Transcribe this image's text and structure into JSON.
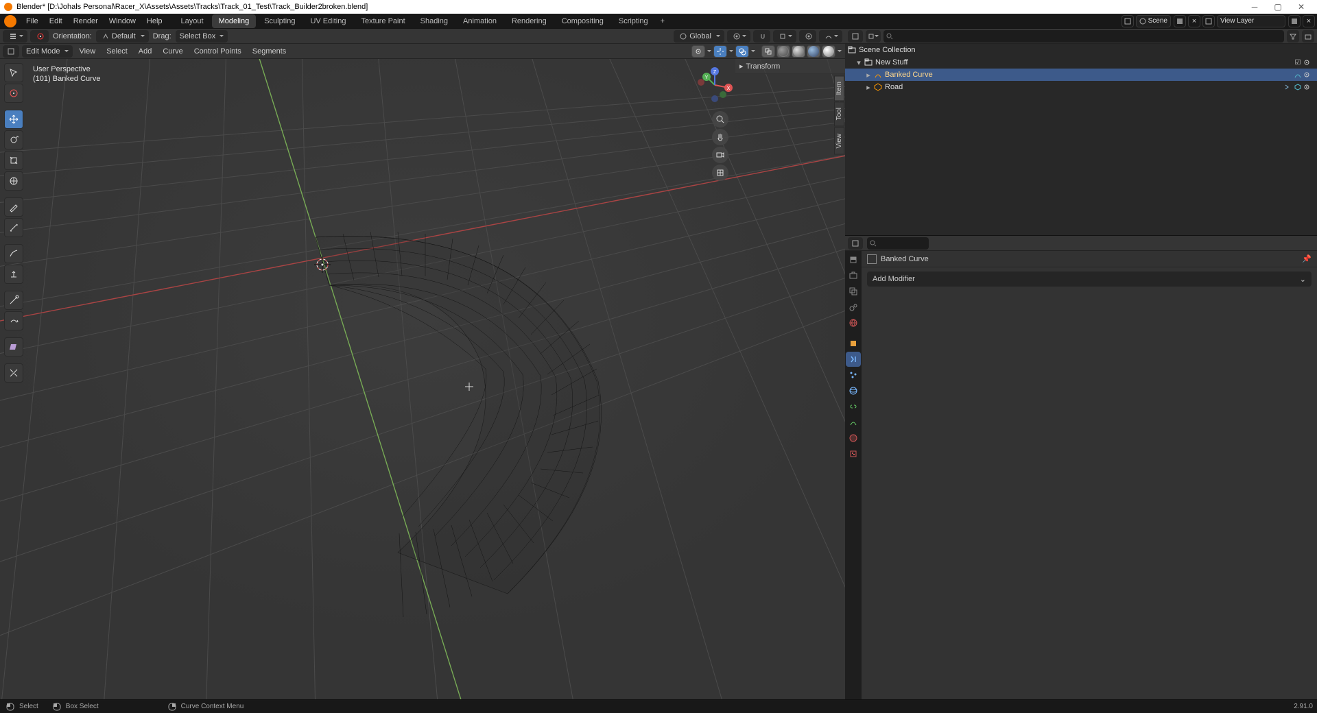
{
  "window": {
    "title": "Blender* [D:\\Johals Personal\\Racer_X\\Assets\\Assets\\Tracks\\Track_01_Test\\Track_Builder2broken.blend]"
  },
  "menu": {
    "items": [
      "File",
      "Edit",
      "Render",
      "Window",
      "Help"
    ],
    "workspaces": [
      "Layout",
      "Modeling",
      "Sculpting",
      "UV Editing",
      "Texture Paint",
      "Shading",
      "Animation",
      "Rendering",
      "Compositing",
      "Scripting"
    ],
    "active_workspace": "Modeling",
    "scene_label": "Scene",
    "viewlayer_label": "View Layer"
  },
  "view_toolbar": {
    "orient_label": "Orientation:",
    "orient_value": "Default",
    "drag_label": "Drag:",
    "drag_value": "Select Box",
    "transform_space": "Global"
  },
  "editmenu": {
    "mode": "Edit Mode",
    "menus": [
      "View",
      "Select",
      "Add",
      "Curve",
      "Control Points",
      "Segments"
    ]
  },
  "overlay": {
    "line1": "User Perspective",
    "line2": "(101) Banked Curve"
  },
  "npanel": {
    "transform": "Transform",
    "tabs": [
      "Item",
      "Tool",
      "View"
    ]
  },
  "outliner": {
    "root": "Scene Collection",
    "items": [
      {
        "name": "New Stuff",
        "type": "collection",
        "depth": 1,
        "expanded": true
      },
      {
        "name": "Banked Curve",
        "type": "curve",
        "depth": 2,
        "selected": true,
        "active": true
      },
      {
        "name": "Road",
        "type": "mesh",
        "depth": 2
      }
    ]
  },
  "properties": {
    "breadcrumb": "Banked Curve",
    "add_modifier": "Add Modifier"
  },
  "statusbar": {
    "select": "Select",
    "box": "Box Select",
    "context": "Curve Context Menu",
    "version": "2.91.0"
  }
}
